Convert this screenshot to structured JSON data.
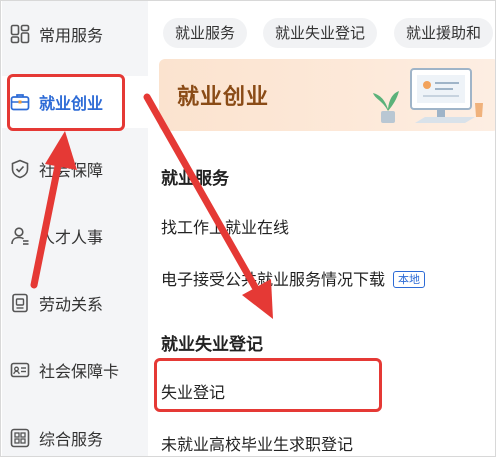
{
  "sidebar": {
    "items": [
      {
        "label": "常用服务",
        "icon": "grid-icon"
      },
      {
        "label": "就业创业",
        "icon": "briefcase-icon",
        "active": true
      },
      {
        "label": "社会保障",
        "icon": "shield-check-icon"
      },
      {
        "label": "人才人事",
        "icon": "person-icon"
      },
      {
        "label": "劳动关系",
        "icon": "document-icon"
      },
      {
        "label": "社会保障卡",
        "icon": "id-card-icon"
      },
      {
        "label": "综合服务",
        "icon": "apps-icon"
      }
    ]
  },
  "chips": [
    "就业服务",
    "就业失业登记",
    "就业援助和"
  ],
  "banner": {
    "title": "就业创业"
  },
  "sections": [
    {
      "title": "就业服务",
      "items": [
        {
          "label": "找工作上就业在线"
        },
        {
          "label": "电子接受公共就业服务情况下载",
          "tag": "本地"
        }
      ]
    },
    {
      "title": "就业失业登记",
      "items": [
        {
          "label": "失业登记"
        },
        {
          "label": "未就业高校毕业生求职登记"
        }
      ]
    }
  ],
  "colors": {
    "accent": "#2d6bd6",
    "annotation": "#e53935",
    "sidebar_bg": "#f4f5f7"
  }
}
